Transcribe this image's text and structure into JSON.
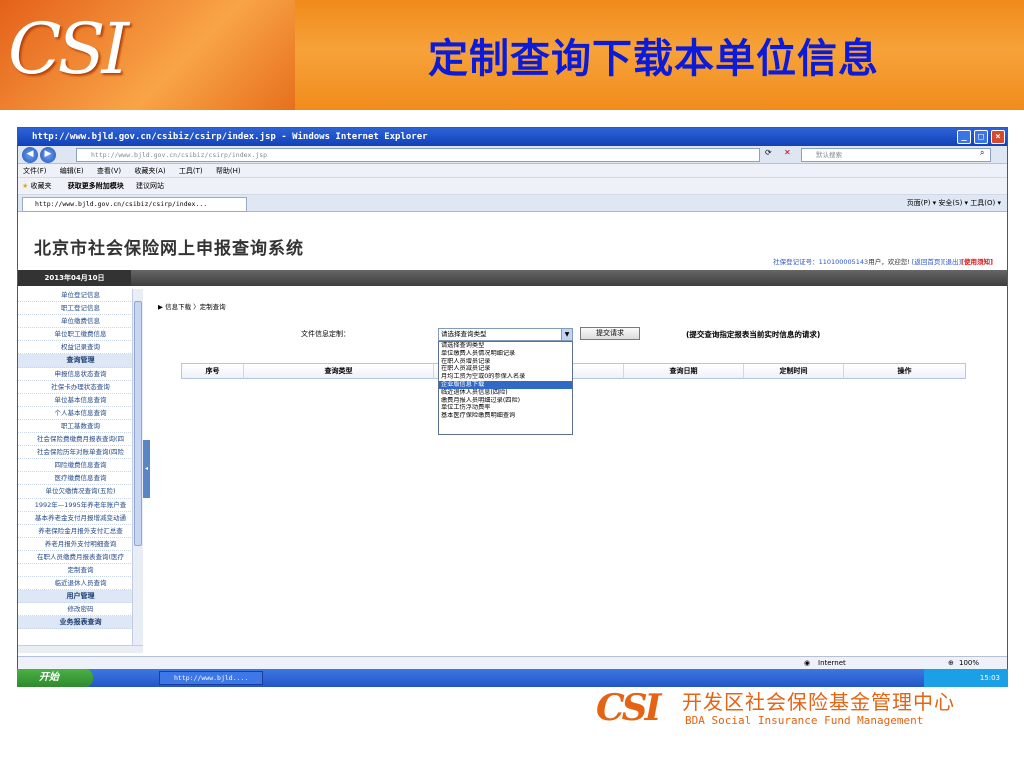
{
  "slide": {
    "logo_text": "CSI",
    "title": "定制查询下载本单位信息",
    "footer_cn": "开发区社会保险基金管理中心",
    "footer_en": "BDA Social Insurance Fund Management"
  },
  "browser": {
    "title": "http://www.bjld.gov.cn/csibiz/csirp/index.jsp - Windows Internet Explorer",
    "address": "http://www.bjld.gov.cn/csibiz/csirp/index.jsp",
    "search_placeholder": "默认搜索",
    "menu": [
      "文件(F)",
      "编辑(E)",
      "查看(V)",
      "收藏夹(A)",
      "工具(T)",
      "帮助(H)"
    ],
    "favorites_label": "收藏夹",
    "fav_item1": "获取更多附加模块",
    "fav_item2": "建议网站",
    "tab_label": "http://www.bjld.gov.cn/csibiz/csirp/index...",
    "tools": "页面(P) ▾  安全(S) ▾  工具(O) ▾",
    "status_zone": "Internet",
    "zoom": "100%"
  },
  "site": {
    "system_title": "北京市社会保险网上申报查询系统",
    "user_prefix": "社保登记证号：",
    "user_id": "110100005143",
    "user_suffix": "用户，欢迎您!",
    "link_home": "[返回首页]",
    "link_exit": "[退出]",
    "link_notice": "[使用须知]",
    "date": "2013年04月10日"
  },
  "sidebar": [
    {
      "label": "单位登记信息",
      "head": false
    },
    {
      "label": "职工登记信息",
      "head": false
    },
    {
      "label": "单位缴费信息",
      "head": false
    },
    {
      "label": "单位职工缴费信息",
      "head": false
    },
    {
      "label": "权益记录查询",
      "head": false
    },
    {
      "label": "查询管理",
      "head": true
    },
    {
      "label": "申报信息状态查询",
      "head": false
    },
    {
      "label": "社保卡办理状态查询",
      "head": false
    },
    {
      "label": "单位基本信息查询",
      "head": false
    },
    {
      "label": "个人基本信息查询",
      "head": false
    },
    {
      "label": "职工基数查询",
      "head": false
    },
    {
      "label": "社会保险费缴费月报表查询(四",
      "head": false
    },
    {
      "label": "社会保险历年对账单查询(四险",
      "head": false
    },
    {
      "label": "四险缴费信息查询",
      "head": false
    },
    {
      "label": "医疗缴费信息查询",
      "head": false
    },
    {
      "label": "单位欠缴情况查询(五险)",
      "head": false
    },
    {
      "label": "1992年—1995年养老年账户查",
      "head": false
    },
    {
      "label": "基本养老金支付月报增减变动通",
      "head": false
    },
    {
      "label": "养老保险金月报外支付汇总查",
      "head": false
    },
    {
      "label": "养老月报外支付明细查询",
      "head": false
    },
    {
      "label": "在职人员缴费月报表查询(医疗",
      "head": false
    },
    {
      "label": "定制查询",
      "head": false
    },
    {
      "label": "临近退休人员查询",
      "head": false
    },
    {
      "label": "用户管理",
      "head": true
    },
    {
      "label": "修改密码",
      "head": false
    },
    {
      "label": "业务报表查询",
      "head": true
    }
  ],
  "main": {
    "breadcrumb": "▶  信息下载 〉定制查询",
    "form_label": "文件信息定制：",
    "select_value": "请选择查询类型",
    "options": [
      "请选择查询类型",
      "单位缴费人员情况明细记录",
      "在职人员增员记录",
      "在职人员减员记录",
      "月均工资为空或0的参保人名录",
      "企业版信息下载",
      "临近退休人员信息(四险)",
      "缴费月报人员明细过录(四险)",
      "单位工伤浮动费率",
      "基本医疗保险缴费明细查询"
    ],
    "selected_index": 5,
    "submit_label": "提交请求",
    "hint": "(提交查询指定报表当前实时信息的请求)",
    "table_headers": [
      "序号",
      "查询类型",
      "",
      "查询日期",
      "定制时间",
      "操作"
    ]
  },
  "taskbar": {
    "start": "开始",
    "task": "http://www.bjld....",
    "clock": "15:03"
  }
}
